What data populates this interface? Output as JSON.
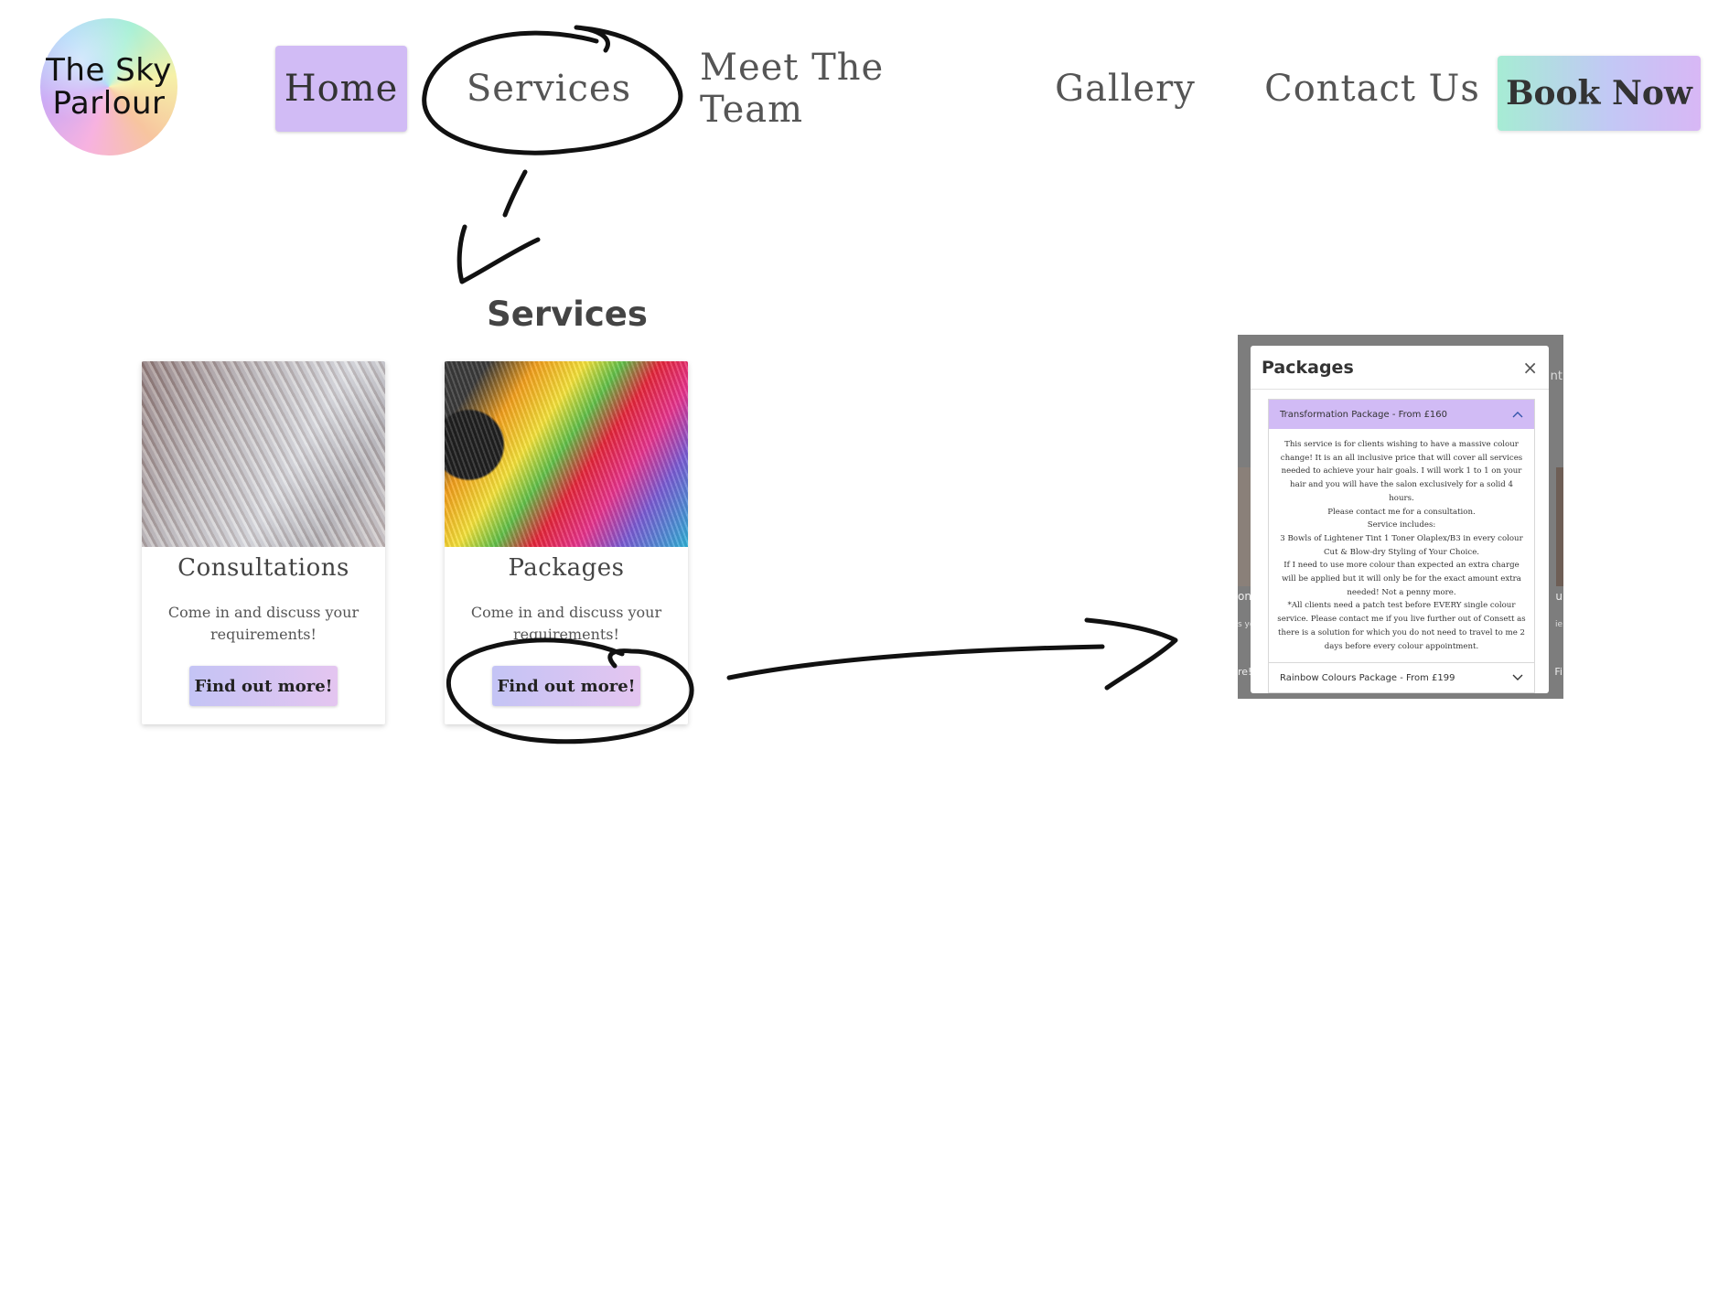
{
  "logo": {
    "line1": "The Sky",
    "line2": "Parlour"
  },
  "nav": {
    "home": "Home",
    "services": "Services",
    "team": "Meet The Team",
    "gallery": "Gallery",
    "contact": "Contact Us",
    "book": "Book Now"
  },
  "section_title": "Services",
  "cards": [
    {
      "name": "Consultations",
      "desc": "Come in and discuss your requirements!",
      "button": "Find out more!"
    },
    {
      "name": "Packages",
      "desc": "Come in and discuss your requirements!",
      "button": "Find out more!"
    }
  ],
  "modal": {
    "title": "Packages",
    "close": "×",
    "open_item": {
      "label": "Transformation Package - From £160",
      "chevron": "^",
      "body": [
        "This service is for clients wishing to have a massive colour change! It is an all inclusive price that will cover all services needed to achieve your hair goals. I will work 1 to 1 on your hair and you will have the salon exclusively for a solid 4 hours.",
        "Please contact me for a consultation.",
        "Service includes:",
        "3 Bowls of Lightener Tint 1 Toner Olaplex/B3 in every colour",
        "Cut & Blow-dry Styling of Your Choice.",
        "If I need to use more colour than expected an extra charge will be applied but it will only be for the exact amount extra needed! Not a penny more.",
        "*All clients need a patch test before EVERY single colour service. Please contact me if you live further out of Consett as there is a solution for which you do not need to travel to me 2 days before every colour appointment."
      ]
    },
    "closed_item": {
      "label": "Rainbow Colours Package - From £199",
      "chevron": "v"
    },
    "background_fragments": {
      "a": "nt",
      "b": "on:",
      "c": "s yo",
      "d": "re!",
      "e": "u",
      "f": "ie",
      "g": "Fi"
    }
  },
  "colors": {
    "nav_active": "#d1bbf5",
    "accordion_open": "#d1bbf5",
    "annotation_ink": "#111111"
  }
}
